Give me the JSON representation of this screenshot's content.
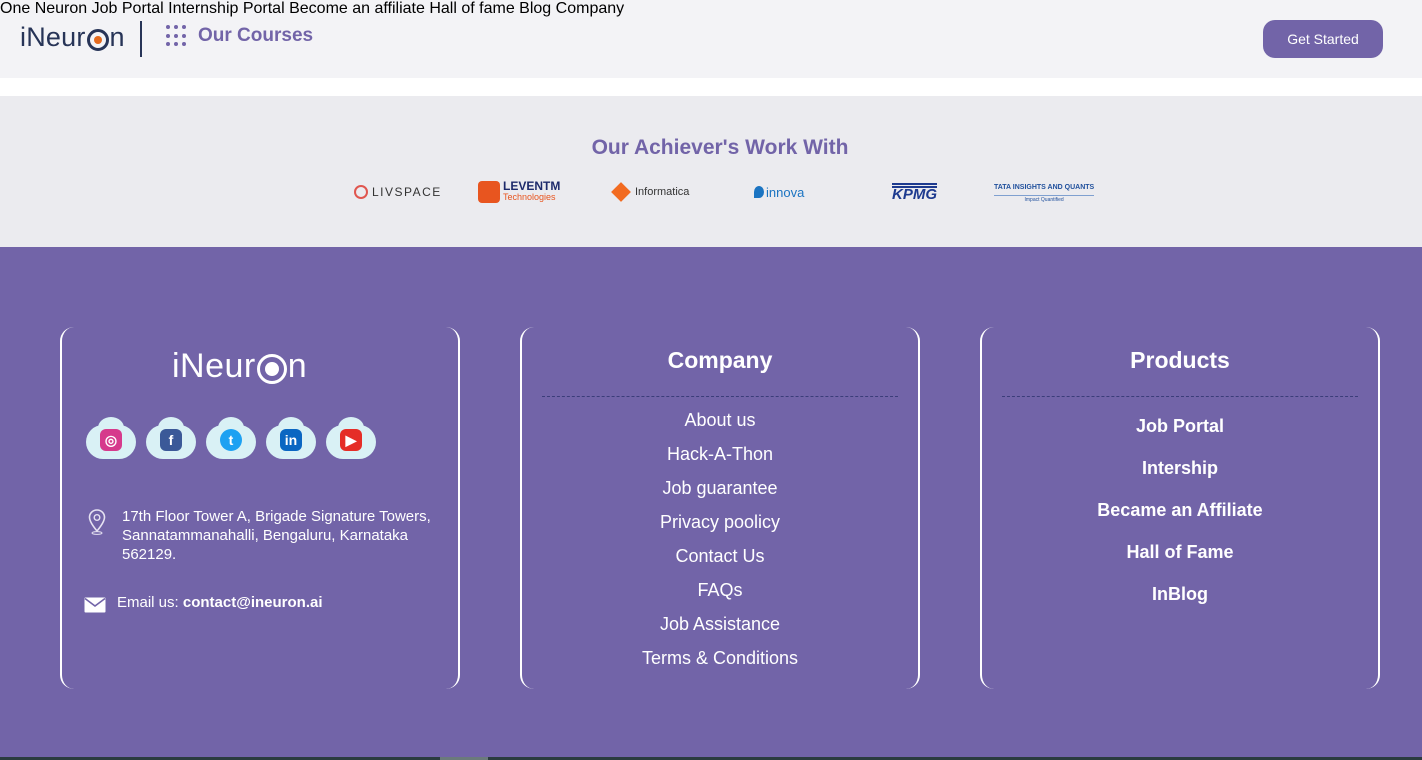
{
  "header": {
    "logo_text_a": "iNeur",
    "logo_text_b": "n",
    "courses_label": "Our Courses",
    "nav": [
      "One Neuron",
      "Job Portal",
      "Internship Portal",
      "Become an affiliate",
      "Hall of fame",
      "Blog",
      "Company"
    ],
    "cta": "Get Started"
  },
  "partners": {
    "title": "Our Achiever's Work With",
    "items": [
      {
        "name": "LIVSPACE",
        "icon": "livspace-logo"
      },
      {
        "name": "LEVENTM",
        "sub": "Technologies",
        "icon": "leventm-logo"
      },
      {
        "name": "Informatica",
        "icon": "informatica-logo"
      },
      {
        "name": "innova",
        "icon": "innova-logo"
      },
      {
        "name": "KPMG",
        "icon": "kpmg-logo"
      },
      {
        "name": "TATA INSIGHTS AND QUANTS",
        "sub": "Impact Quantified",
        "icon": "tata-iq-logo"
      }
    ]
  },
  "footer": {
    "brand": {
      "logo_text_a": "iNeur",
      "logo_text_b": "n",
      "socials": [
        {
          "name": "instagram-icon",
          "color": "#d63a8c"
        },
        {
          "name": "facebook-icon",
          "color": "#3b5998"
        },
        {
          "name": "twitter-icon",
          "color": "#1da1f2"
        },
        {
          "name": "linkedin-icon",
          "color": "#0a66c2"
        },
        {
          "name": "youtube-icon",
          "color": "#e52d27"
        }
      ],
      "address": "17th Floor Tower A, Brigade Signature Towers, Sannatammanahalli, Bengaluru, Karnataka 562129.",
      "email_prefix": "Email us: ",
      "email": "contact@ineuron.ai"
    },
    "company": {
      "title": "Company",
      "links": [
        "About us",
        "Hack-A-Thon",
        "Job guarantee",
        "Privacy poolicy",
        "Contact Us",
        "FAQs",
        "Job Assistance",
        "Terms & Conditions"
      ]
    },
    "products": {
      "title": "Products",
      "links": [
        "Job Portal",
        "Intership",
        "Became an Affiliate",
        "Hall of Fame",
        "InBlog"
      ]
    }
  },
  "colors": {
    "accent": "#7264a8",
    "navy": "#273457",
    "orange": "#e46a1e"
  }
}
